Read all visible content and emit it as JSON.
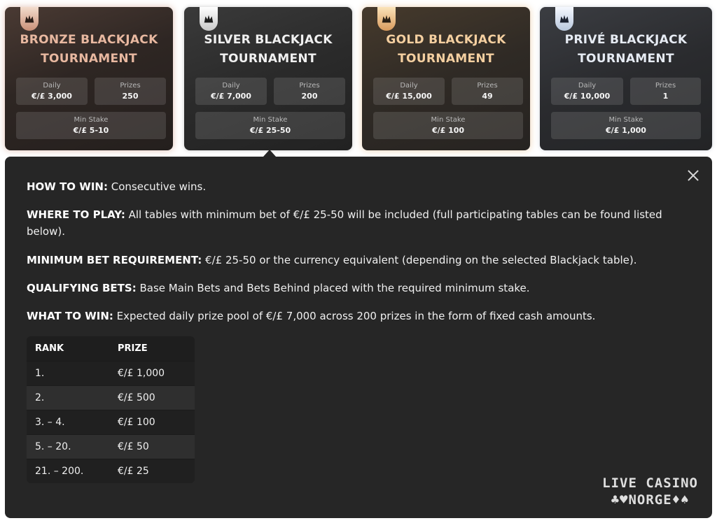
{
  "tournaments": [
    {
      "tier": "bronze",
      "title_line1": "BRONZE BLACKJACK",
      "title_line2": "TOURNAMENT",
      "daily_label": "Daily",
      "daily_value": "€/£ 3,000",
      "prizes_label": "Prizes",
      "prizes_value": "250",
      "min_stake_label": "Min Stake",
      "min_stake_value": "€/£ 5-10"
    },
    {
      "tier": "silver",
      "title_line1": "SILVER BLACKJACK",
      "title_line2": "TOURNAMENT",
      "daily_label": "Daily",
      "daily_value": "€/£ 7,000",
      "prizes_label": "Prizes",
      "prizes_value": "200",
      "min_stake_label": "Min Stake",
      "min_stake_value": "€/£ 25-50"
    },
    {
      "tier": "gold",
      "title_line1": "GOLD BLACKJACK",
      "title_line2": "TOURNAMENT",
      "daily_label": "Daily",
      "daily_value": "€/£ 15,000",
      "prizes_label": "Prizes",
      "prizes_value": "49",
      "min_stake_label": "Min Stake",
      "min_stake_value": "€/£ 100"
    },
    {
      "tier": "prive",
      "title_line1": "PRIVÉ BLACKJACK",
      "title_line2": "TOURNAMENT",
      "daily_label": "Daily",
      "daily_value": "€/£ 10,000",
      "prizes_label": "Prizes",
      "prizes_value": "1",
      "min_stake_label": "Min Stake",
      "min_stake_value": "€/£ 1,000"
    }
  ],
  "details": {
    "selected_tier": "silver",
    "rules": [
      {
        "label": "HOW TO WIN:",
        "text": " Consecutive wins."
      },
      {
        "label": "WHERE TO PLAY:",
        "text": " All tables with minimum bet of €/£ 25-50 will be included (full participating tables can be found listed below)."
      },
      {
        "label": "MINIMUM BET REQUIREMENT:",
        "text": " €/£ 25-50 or the currency equivalent (depending on the selected Blackjack table)."
      },
      {
        "label": "QUALIFYING BETS:",
        "text": " Base Main Bets and Bets Behind placed with the required minimum stake."
      },
      {
        "label": "WHAT TO WIN:",
        "text": " Expected daily prize pool of €/£ 7,000 across 200 prizes in the form of fixed cash amounts."
      }
    ],
    "table": {
      "headers": [
        "RANK",
        "PRIZE"
      ],
      "rows": [
        [
          "1.",
          "€/£ 1,000"
        ],
        [
          "2.",
          "€/£ 500"
        ],
        [
          "3. – 4.",
          "€/£ 100"
        ],
        [
          "5. – 20.",
          "€/£ 50"
        ],
        [
          "21. – 200.",
          "€/£ 25"
        ]
      ]
    }
  },
  "icons": {
    "badge": "crown-emblem-icon",
    "close": "close-icon"
  },
  "watermark": {
    "line1": "LIVE CASINO",
    "line2": "♣♥NORGE♦♠"
  }
}
